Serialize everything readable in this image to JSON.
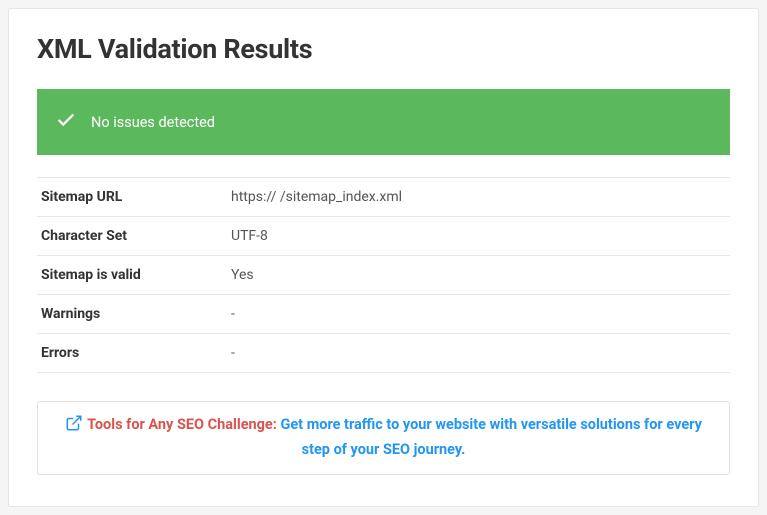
{
  "title": "XML Validation Results",
  "status": {
    "message": "No issues detected"
  },
  "results": {
    "rows": [
      {
        "label": "Sitemap URL",
        "value": "https://                                         /sitemap_index.xml"
      },
      {
        "label": "Character Set",
        "value": "UTF-8"
      },
      {
        "label": "Sitemap is valid",
        "value": "Yes"
      },
      {
        "label": "Warnings",
        "value": "-"
      },
      {
        "label": "Errors",
        "value": "-"
      }
    ]
  },
  "promo": {
    "lead": "Tools for Any SEO Challenge:",
    "link_text": "Get more traffic to your website with versatile solutions for every step of your SEO journey."
  }
}
